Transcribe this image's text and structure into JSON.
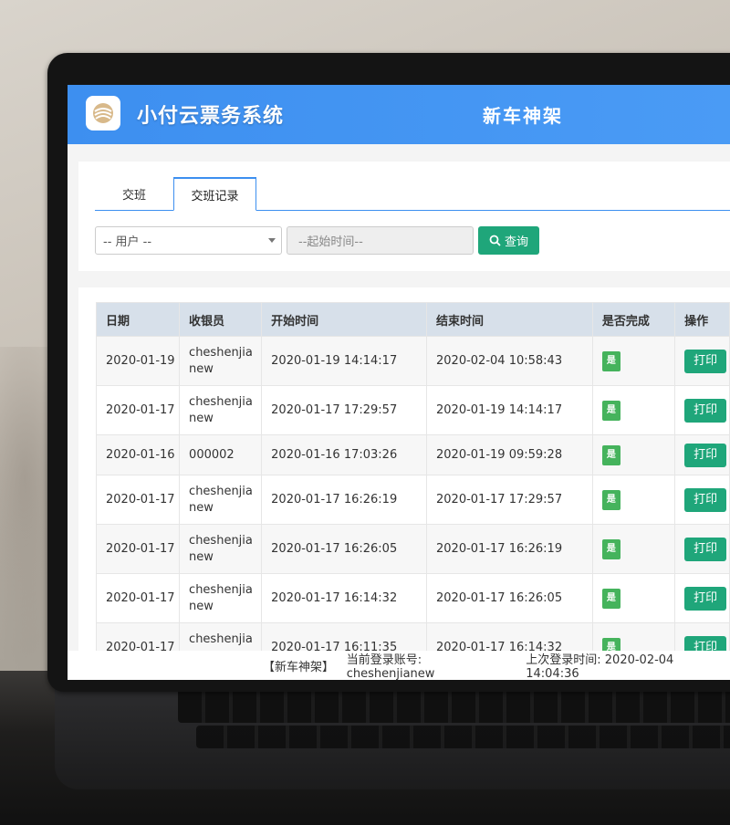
{
  "app": {
    "title": "小付云票务系统",
    "org_name": "新车神架",
    "brand_color": "#3d8ff0",
    "action_color": "#1fa67a"
  },
  "tabs": [
    {
      "label": "交班",
      "active": false
    },
    {
      "label": "交班记录",
      "active": true
    }
  ],
  "filters": {
    "user_select": "-- 用户 --",
    "start_time_placeholder": "--起始时间--",
    "search_label": "查询",
    "search_icon": "search-icon"
  },
  "table": {
    "headers": [
      "日期",
      "收银员",
      "开始时间",
      "结束时间",
      "是否完成",
      "操作"
    ],
    "rows": [
      {
        "date": "2020-01-19",
        "cashier": "cheshenjianew",
        "start": "2020-01-19 14:14:17",
        "end": "2020-02-04 10:58:43",
        "done": "是",
        "action": "打印"
      },
      {
        "date": "2020-01-17",
        "cashier": "cheshenjianew",
        "start": "2020-01-17 17:29:57",
        "end": "2020-01-19 14:14:17",
        "done": "是",
        "action": "打印"
      },
      {
        "date": "2020-01-16",
        "cashier": "000002",
        "start": "2020-01-16 17:03:26",
        "end": "2020-01-19 09:59:28",
        "done": "是",
        "action": "打印"
      },
      {
        "date": "2020-01-17",
        "cashier": "cheshenjianew",
        "start": "2020-01-17 16:26:19",
        "end": "2020-01-17 17:29:57",
        "done": "是",
        "action": "打印"
      },
      {
        "date": "2020-01-17",
        "cashier": "cheshenjianew",
        "start": "2020-01-17 16:26:05",
        "end": "2020-01-17 16:26:19",
        "done": "是",
        "action": "打印"
      },
      {
        "date": "2020-01-17",
        "cashier": "cheshenjianew",
        "start": "2020-01-17 16:14:32",
        "end": "2020-01-17 16:26:05",
        "done": "是",
        "action": "打印"
      },
      {
        "date": "2020-01-17",
        "cashier": "cheshenjianew",
        "start": "2020-01-17 16:11:35",
        "end": "2020-01-17 16:14:32",
        "done": "是",
        "action": "打印"
      }
    ]
  },
  "footer": {
    "org": "【新车神架】",
    "account_label": "当前登录账号:",
    "account": "cheshenjianew",
    "last_login_label": "上次登录时间:",
    "last_login": "2020-02-04 14:04:36"
  }
}
